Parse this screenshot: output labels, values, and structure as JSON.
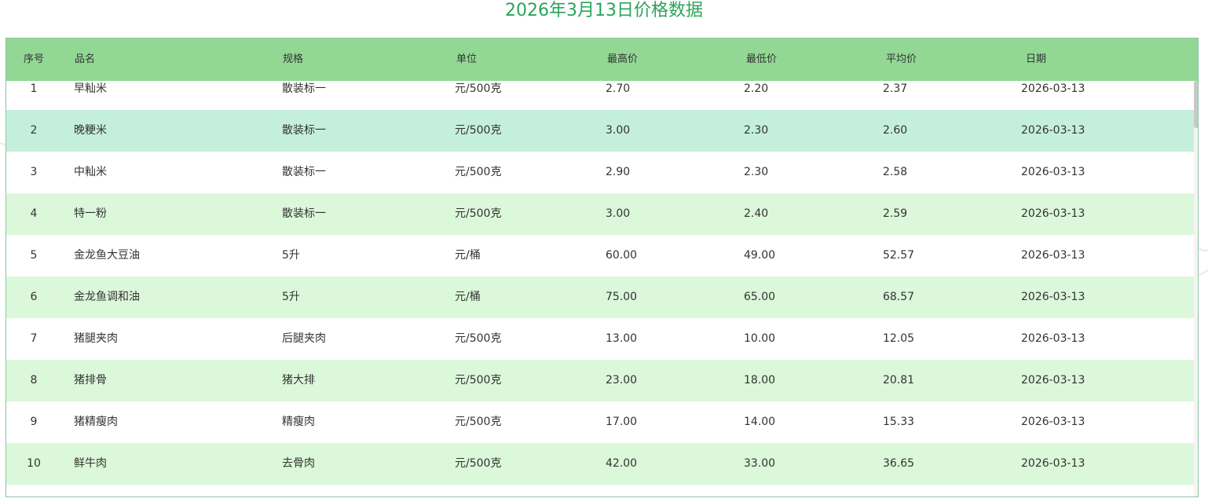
{
  "title": "2026年3月13日价格数据",
  "table": {
    "headers": {
      "index": "序号",
      "name": "品名",
      "spec": "规格",
      "unit": "单位",
      "max": "最高价",
      "min": "最低价",
      "avg": "平均价",
      "date": "日期"
    },
    "rows": [
      {
        "index": "1",
        "name": "早籼米",
        "spec": "散装标一",
        "unit": "元/500克",
        "max": "2.70",
        "min": "2.20",
        "avg": "2.37",
        "date": "2026-03-13"
      },
      {
        "index": "2",
        "name": "晚粳米",
        "spec": "散装标一",
        "unit": "元/500克",
        "max": "3.00",
        "min": "2.30",
        "avg": "2.60",
        "date": "2026-03-13"
      },
      {
        "index": "3",
        "name": "中籼米",
        "spec": "散装标一",
        "unit": "元/500克",
        "max": "2.90",
        "min": "2.30",
        "avg": "2.58",
        "date": "2026-03-13"
      },
      {
        "index": "4",
        "name": "特一粉",
        "spec": "散装标一",
        "unit": "元/500克",
        "max": "3.00",
        "min": "2.40",
        "avg": "2.59",
        "date": "2026-03-13"
      },
      {
        "index": "5",
        "name": "金龙鱼大豆油",
        "spec": "5升",
        "unit": "元/桶",
        "max": "60.00",
        "min": "49.00",
        "avg": "52.57",
        "date": "2026-03-13"
      },
      {
        "index": "6",
        "name": "金龙鱼调和油",
        "spec": "5升",
        "unit": "元/桶",
        "max": "75.00",
        "min": "65.00",
        "avg": "68.57",
        "date": "2026-03-13"
      },
      {
        "index": "7",
        "name": "猪腿夹肉",
        "spec": "后腿夹肉",
        "unit": "元/500克",
        "max": "13.00",
        "min": "10.00",
        "avg": "12.05",
        "date": "2026-03-13"
      },
      {
        "index": "8",
        "name": "猪排骨",
        "spec": "猪大排",
        "unit": "元/500克",
        "max": "23.00",
        "min": "18.00",
        "avg": "20.81",
        "date": "2026-03-13"
      },
      {
        "index": "9",
        "name": "猪精瘦肉",
        "spec": "精瘦肉",
        "unit": "元/500克",
        "max": "17.00",
        "min": "14.00",
        "avg": "15.33",
        "date": "2026-03-13"
      },
      {
        "index": "10",
        "name": "鲜牛肉",
        "spec": "去骨肉",
        "unit": "元/500克",
        "max": "42.00",
        "min": "33.00",
        "avg": "36.65",
        "date": "2026-03-13"
      }
    ]
  },
  "colors": {
    "title": "#2aa35a",
    "header_bg": "#92d894",
    "row_alt_bg": "#dbf8da",
    "row_hover_bg": "#c5efdd",
    "border": "#8dc4a6"
  }
}
